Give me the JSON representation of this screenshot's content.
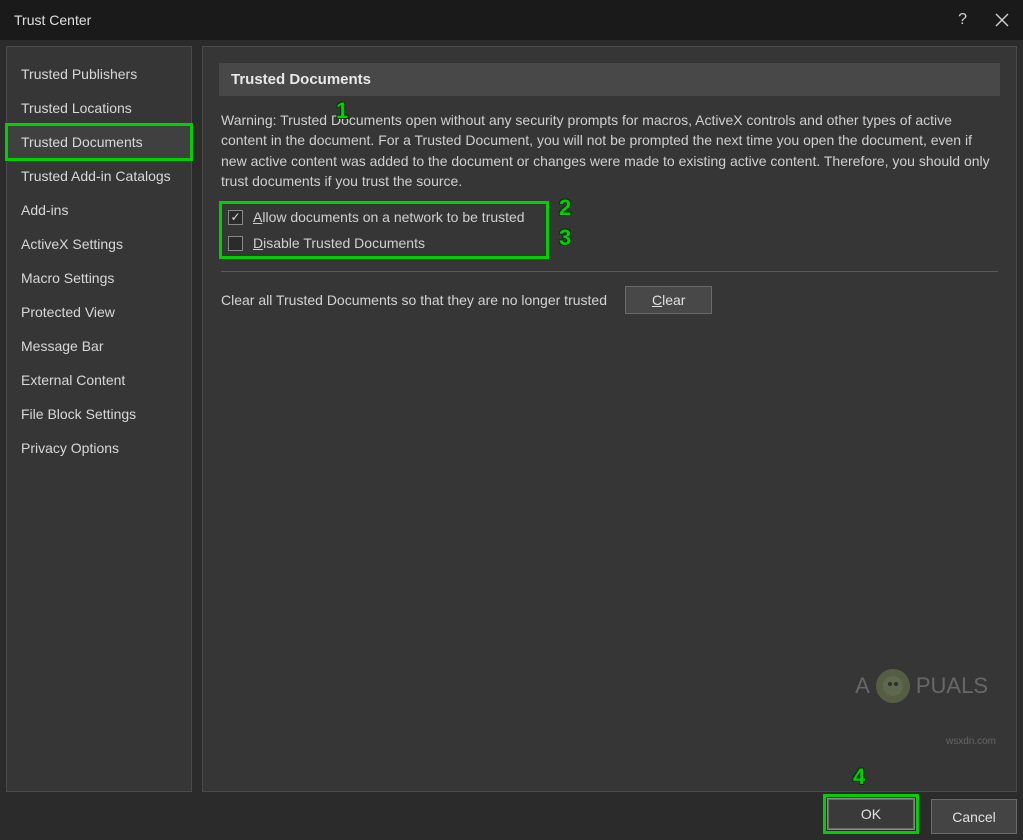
{
  "titlebar": {
    "title": "Trust Center"
  },
  "sidebar": {
    "items": [
      {
        "label": "Trusted Publishers",
        "selected": false
      },
      {
        "label": "Trusted Locations",
        "selected": false
      },
      {
        "label": "Trusted Documents",
        "selected": true
      },
      {
        "label": "Trusted Add-in Catalogs",
        "selected": false
      },
      {
        "label": "Add-ins",
        "selected": false
      },
      {
        "label": "ActiveX Settings",
        "selected": false
      },
      {
        "label": "Macro Settings",
        "selected": false
      },
      {
        "label": "Protected View",
        "selected": false
      },
      {
        "label": "Message Bar",
        "selected": false
      },
      {
        "label": "External Content",
        "selected": false
      },
      {
        "label": "File Block Settings",
        "selected": false
      },
      {
        "label": "Privacy Options",
        "selected": false
      }
    ]
  },
  "content": {
    "header": "Trusted Documents",
    "warning": "Warning: Trusted Documents open without any security prompts for macros, ActiveX controls and other types of active content in the document.  For a Trusted Document, you will not be prompted the next time you open the document, even if new active content was added to the document or changes were made to existing active content. Therefore, you should only trust documents if you trust the source.",
    "checkbox1": {
      "label_pre": "",
      "label_u": "A",
      "label_post": "llow documents on a network to be trusted",
      "checked": true
    },
    "checkbox2": {
      "label_pre": "",
      "label_u": "D",
      "label_post": "isable Trusted Documents",
      "checked": false
    },
    "clear_text": "Clear all Trusted Documents so that they are no longer trusted",
    "clear_button_u": "C",
    "clear_button_post": "lear"
  },
  "footer": {
    "ok": "OK",
    "cancel": "Cancel"
  },
  "annotations": {
    "n1": "1",
    "n2": "2",
    "n3": "3",
    "n4": "4"
  },
  "watermark": {
    "pre": "A",
    "post": "PUALS"
  },
  "credit": "wsxdn.com"
}
